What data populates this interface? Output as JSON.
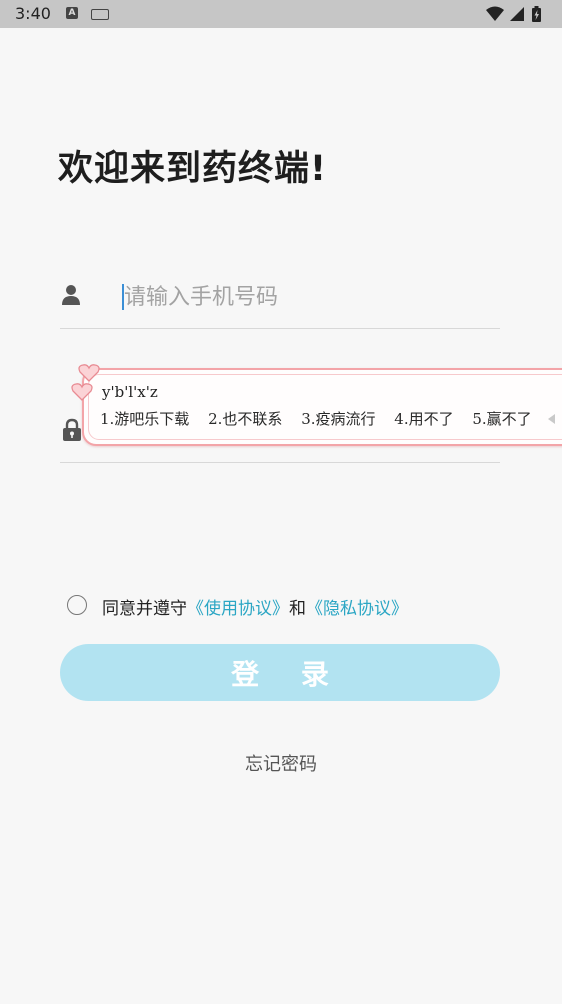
{
  "status_bar": {
    "time": "3:40",
    "a_label": "A"
  },
  "welcome_title": "欢迎来到药终端!",
  "phone_field": {
    "placeholder": "请输入手机号码",
    "value": ""
  },
  "ime": {
    "pinyin": "y'b'l'x'z",
    "candidates": [
      "1.游吧乐下载",
      "2.也不联系",
      "3.疫病流行",
      "4.用不了",
      "5.赢不了"
    ]
  },
  "agreement": {
    "prefix": "同意并遵守",
    "usage_link": "《使用协议》",
    "and": "和",
    "privacy_link": "《隐私协议》",
    "checked": false
  },
  "login_button": "登 录",
  "forgot_password": "忘记密码",
  "colors": {
    "accent_link": "#2ba6c4",
    "login_button_bg": "#b2e3f1",
    "ime_border": "#f3a4a8"
  }
}
